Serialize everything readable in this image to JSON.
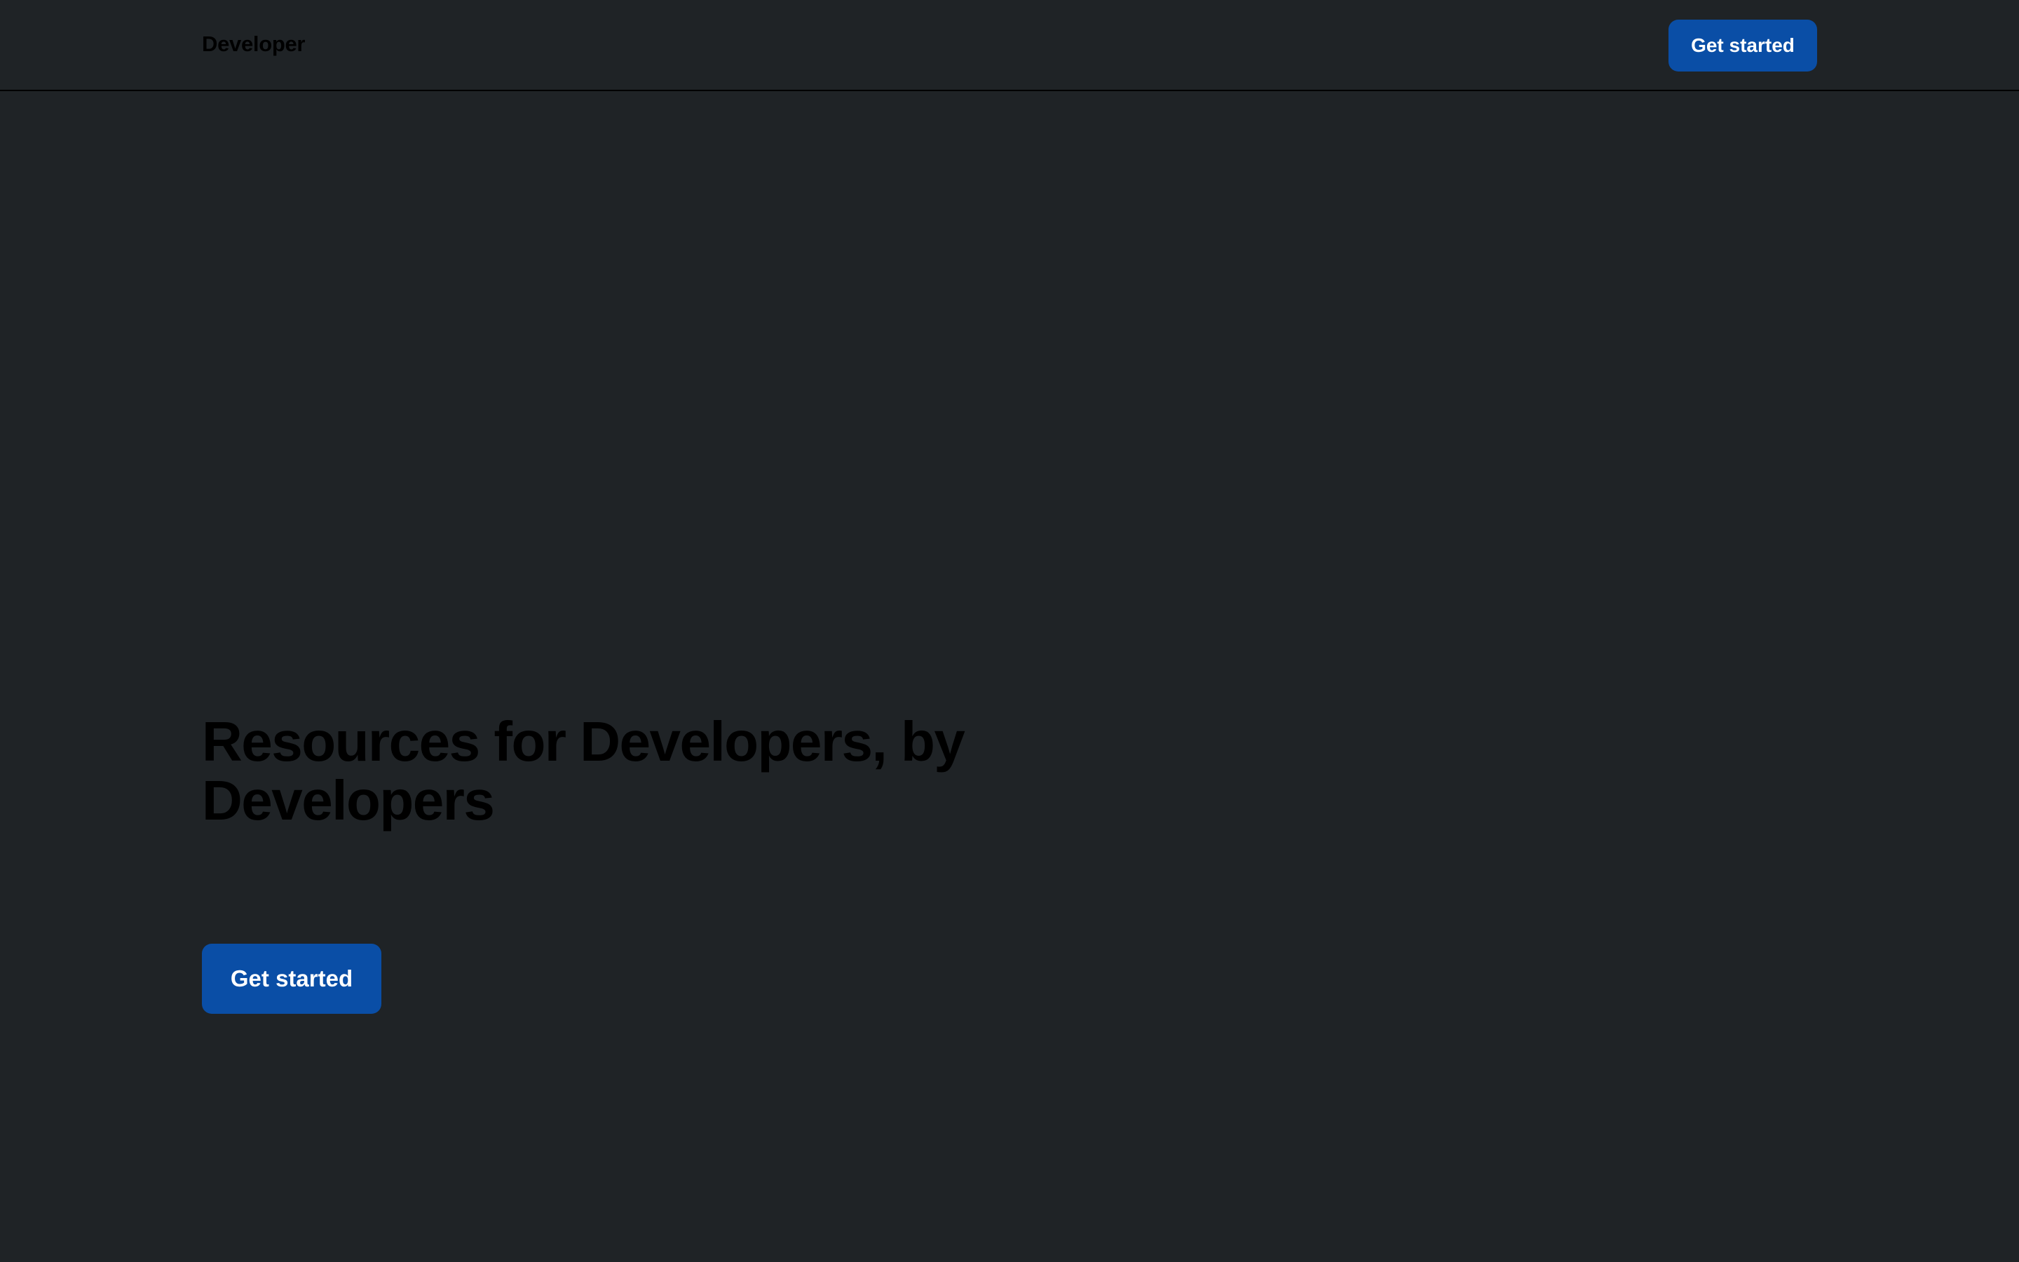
{
  "header": {
    "brand": "Developer",
    "cta_label": "Get started"
  },
  "hero": {
    "title": "Resources for Developers, by Developers",
    "cta_label": "Get started"
  },
  "colors": {
    "background": "#1f2326",
    "primary_button": "#0a4ea6",
    "button_text": "#ffffff",
    "text": "#000000"
  }
}
